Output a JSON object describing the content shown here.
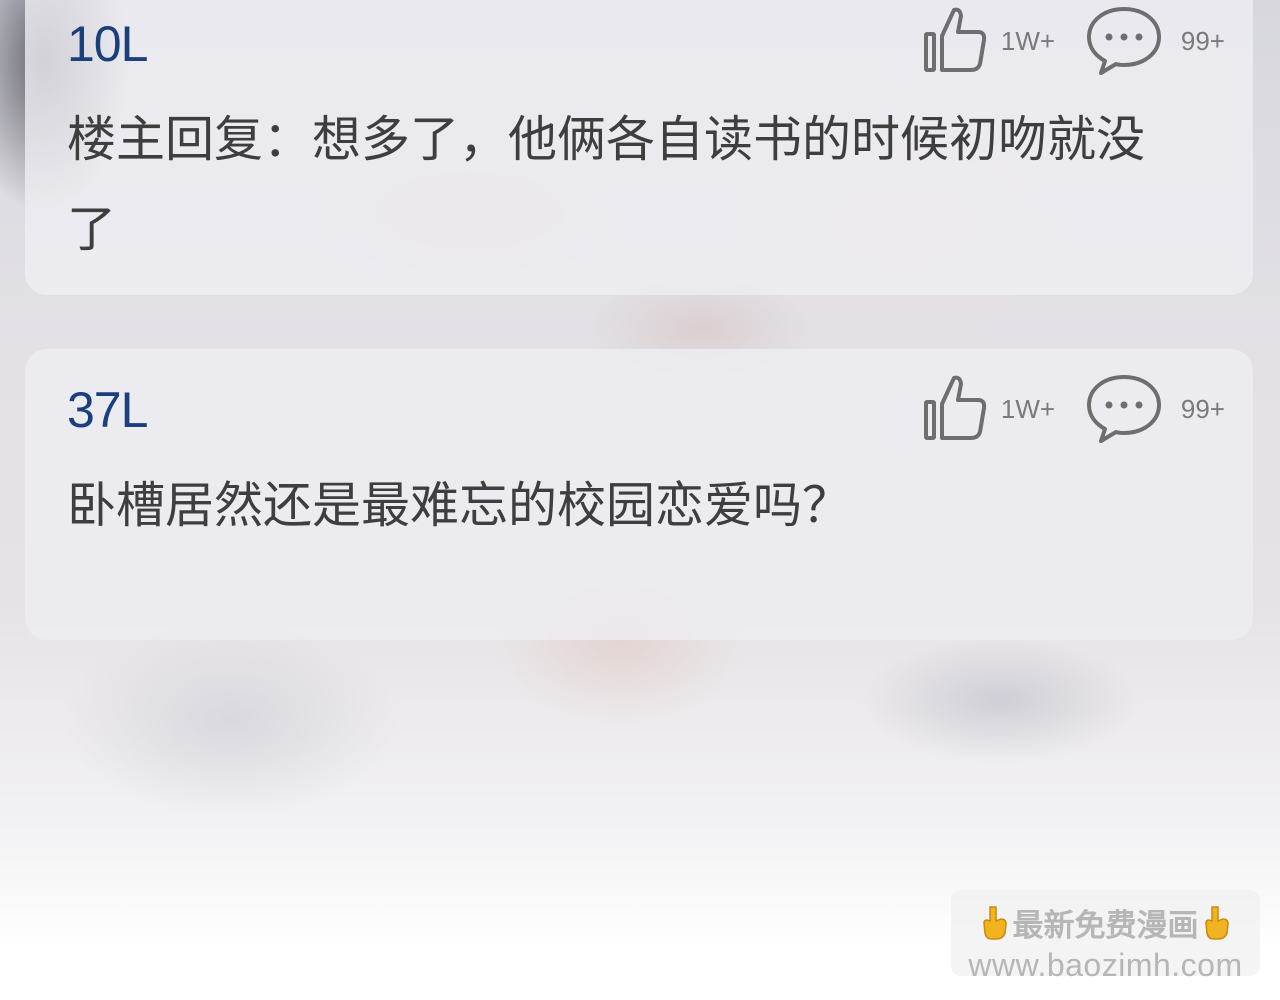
{
  "comments": [
    {
      "floor": "10L",
      "likes": "1W+",
      "replies": "99+",
      "text": "楼主回复：想多了，他俩各自读书的时候初吻就没了"
    },
    {
      "floor": "37L",
      "likes": "1W+",
      "replies": "99+",
      "text": "卧槽居然还是最难忘的校园恋爱吗？"
    }
  ],
  "watermark": {
    "line1": "最新免费漫画",
    "line2": "www.baozimh.com"
  },
  "colors": {
    "floor": "#1a3f7c",
    "text": "#3e3e3e",
    "icon": "#6e6e6e",
    "hand": "#f2b320"
  },
  "icons": [
    "thumbs-up-icon",
    "comment-bubble-icon",
    "pointing-down-hand-icon"
  ]
}
